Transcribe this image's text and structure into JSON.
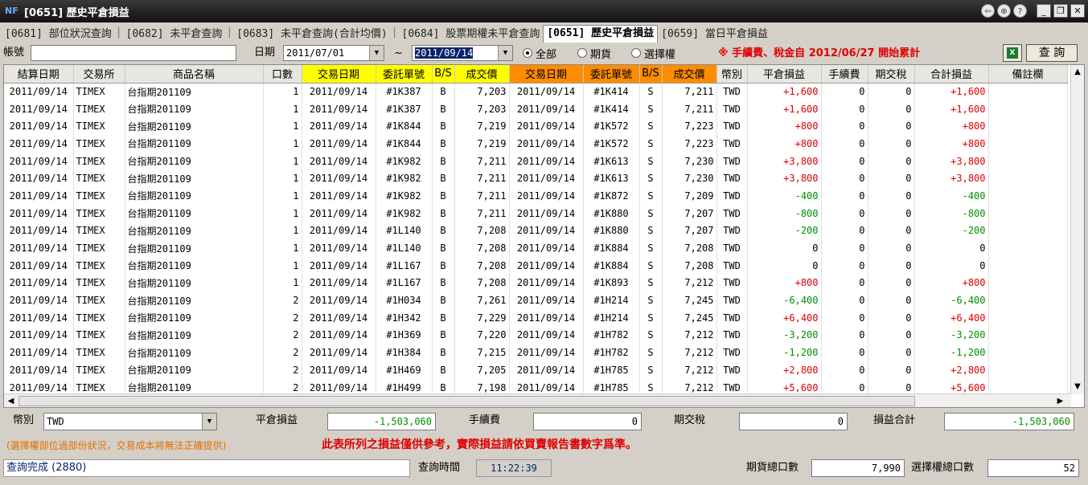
{
  "window": {
    "logo": "NF",
    "title": "[0651] 歷史平倉損益",
    "controls": [
      "⇦",
      "⊕",
      "?",
      "_",
      "❐",
      "✕"
    ]
  },
  "tabs": [
    {
      "label": "[0681] 部位狀況查詢",
      "active": false
    },
    {
      "label": "[0682] 未平倉查詢",
      "active": false
    },
    {
      "label": "[0683] 未平倉查詢(合計均價)",
      "active": false
    },
    {
      "label": "[0684] 股票期權未平倉查詢",
      "active": false
    },
    {
      "label": "[0651] 歷史平倉損益",
      "active": true
    },
    {
      "label": "[0659] 當日平倉損益",
      "active": false
    }
  ],
  "filter": {
    "account_label": "帳號",
    "account_value": "",
    "date_label": "日期",
    "date_from": "2011/07/01",
    "date_sep": "~",
    "date_to": "2011/09/14",
    "radio_all": "全部",
    "radio_futures": "期貨",
    "radio_options": "選擇權",
    "notice": "※ 手續費、稅金自 2012/06/27 開始累計",
    "query_button": "查 詢"
  },
  "table": {
    "headers": [
      "結算日期",
      "交易所",
      "商品名稱",
      "口數",
      "交易日期",
      "委託單號",
      "B/S",
      "成交價",
      "交易日期",
      "委託單號",
      "B/S",
      "成交價",
      "幣別",
      "平倉損益",
      "手續費",
      "期交稅",
      "合計損益",
      "備註欄"
    ],
    "rows": [
      [
        "2011/09/14",
        "TIMEX",
        "台指期201109",
        "1",
        "2011/09/14",
        "#1K387",
        "B",
        "7,203",
        "2011/09/14",
        "#1K414",
        "S",
        "7,211",
        "TWD",
        "+1,600",
        "0",
        "0",
        "+1,600",
        ""
      ],
      [
        "2011/09/14",
        "TIMEX",
        "台指期201109",
        "1",
        "2011/09/14",
        "#1K387",
        "B",
        "7,203",
        "2011/09/14",
        "#1K414",
        "S",
        "7,211",
        "TWD",
        "+1,600",
        "0",
        "0",
        "+1,600",
        ""
      ],
      [
        "2011/09/14",
        "TIMEX",
        "台指期201109",
        "1",
        "2011/09/14",
        "#1K844",
        "B",
        "7,219",
        "2011/09/14",
        "#1K572",
        "S",
        "7,223",
        "TWD",
        "+800",
        "0",
        "0",
        "+800",
        ""
      ],
      [
        "2011/09/14",
        "TIMEX",
        "台指期201109",
        "1",
        "2011/09/14",
        "#1K844",
        "B",
        "7,219",
        "2011/09/14",
        "#1K572",
        "S",
        "7,223",
        "TWD",
        "+800",
        "0",
        "0",
        "+800",
        ""
      ],
      [
        "2011/09/14",
        "TIMEX",
        "台指期201109",
        "1",
        "2011/09/14",
        "#1K982",
        "B",
        "7,211",
        "2011/09/14",
        "#1K613",
        "S",
        "7,230",
        "TWD",
        "+3,800",
        "0",
        "0",
        "+3,800",
        ""
      ],
      [
        "2011/09/14",
        "TIMEX",
        "台指期201109",
        "1",
        "2011/09/14",
        "#1K982",
        "B",
        "7,211",
        "2011/09/14",
        "#1K613",
        "S",
        "7,230",
        "TWD",
        "+3,800",
        "0",
        "0",
        "+3,800",
        ""
      ],
      [
        "2011/09/14",
        "TIMEX",
        "台指期201109",
        "1",
        "2011/09/14",
        "#1K982",
        "B",
        "7,211",
        "2011/09/14",
        "#1K872",
        "S",
        "7,209",
        "TWD",
        "-400",
        "0",
        "0",
        "-400",
        ""
      ],
      [
        "2011/09/14",
        "TIMEX",
        "台指期201109",
        "1",
        "2011/09/14",
        "#1K982",
        "B",
        "7,211",
        "2011/09/14",
        "#1K880",
        "S",
        "7,207",
        "TWD",
        "-800",
        "0",
        "0",
        "-800",
        ""
      ],
      [
        "2011/09/14",
        "TIMEX",
        "台指期201109",
        "1",
        "2011/09/14",
        "#1L140",
        "B",
        "7,208",
        "2011/09/14",
        "#1K880",
        "S",
        "7,207",
        "TWD",
        "-200",
        "0",
        "0",
        "-200",
        ""
      ],
      [
        "2011/09/14",
        "TIMEX",
        "台指期201109",
        "1",
        "2011/09/14",
        "#1L140",
        "B",
        "7,208",
        "2011/09/14",
        "#1K884",
        "S",
        "7,208",
        "TWD",
        "0",
        "0",
        "0",
        "0",
        ""
      ],
      [
        "2011/09/14",
        "TIMEX",
        "台指期201109",
        "1",
        "2011/09/14",
        "#1L167",
        "B",
        "7,208",
        "2011/09/14",
        "#1K884",
        "S",
        "7,208",
        "TWD",
        "0",
        "0",
        "0",
        "0",
        ""
      ],
      [
        "2011/09/14",
        "TIMEX",
        "台指期201109",
        "1",
        "2011/09/14",
        "#1L167",
        "B",
        "7,208",
        "2011/09/14",
        "#1K893",
        "S",
        "7,212",
        "TWD",
        "+800",
        "0",
        "0",
        "+800",
        ""
      ],
      [
        "2011/09/14",
        "TIMEX",
        "台指期201109",
        "2",
        "2011/09/14",
        "#1H034",
        "B",
        "7,261",
        "2011/09/14",
        "#1H214",
        "S",
        "7,245",
        "TWD",
        "-6,400",
        "0",
        "0",
        "-6,400",
        ""
      ],
      [
        "2011/09/14",
        "TIMEX",
        "台指期201109",
        "2",
        "2011/09/14",
        "#1H342",
        "B",
        "7,229",
        "2011/09/14",
        "#1H214",
        "S",
        "7,245",
        "TWD",
        "+6,400",
        "0",
        "0",
        "+6,400",
        ""
      ],
      [
        "2011/09/14",
        "TIMEX",
        "台指期201109",
        "2",
        "2011/09/14",
        "#1H369",
        "B",
        "7,220",
        "2011/09/14",
        "#1H782",
        "S",
        "7,212",
        "TWD",
        "-3,200",
        "0",
        "0",
        "-3,200",
        ""
      ],
      [
        "2011/09/14",
        "TIMEX",
        "台指期201109",
        "2",
        "2011/09/14",
        "#1H384",
        "B",
        "7,215",
        "2011/09/14",
        "#1H782",
        "S",
        "7,212",
        "TWD",
        "-1,200",
        "0",
        "0",
        "-1,200",
        ""
      ],
      [
        "2011/09/14",
        "TIMEX",
        "台指期201109",
        "2",
        "2011/09/14",
        "#1H469",
        "B",
        "7,205",
        "2011/09/14",
        "#1H785",
        "S",
        "7,212",
        "TWD",
        "+2,800",
        "0",
        "0",
        "+2,800",
        ""
      ],
      [
        "2011/09/14",
        "TIMEX",
        "台指期201109",
        "2",
        "2011/09/14",
        "#1H499",
        "B",
        "7,198",
        "2011/09/14",
        "#1H785",
        "S",
        "7,212",
        "TWD",
        "+5,600",
        "0",
        "0",
        "+5,600",
        ""
      ]
    ]
  },
  "scrollbar": {
    "up": "▲",
    "down": "▼",
    "left": "◀",
    "right": "▶"
  },
  "summary": {
    "currency_label": "幣別",
    "currency_value": "TWD",
    "pnl_label": "平倉損益",
    "pnl_value": "-1,503,060",
    "fee_label": "手續費",
    "fee_value": "0",
    "tax_label": "期交稅",
    "tax_value": "0",
    "total_label": "損益合計",
    "total_value": "-1,503,060"
  },
  "notes": {
    "orange": "(選擇權部位過部份狀況，交易成本將無法正確提供)",
    "red": "此表所列之損益僅供參考，實際損益請依買賣報告書數字爲準。"
  },
  "status": {
    "message": "查詢完成 (2880)",
    "time_label": "查詢時間",
    "time_value": "11:22:39",
    "futures_label": "期貨總口數",
    "futures_value": "7,990",
    "options_label": "選擇權總口數",
    "options_value": "52"
  },
  "colors": {
    "header_yellow": "#ffff00",
    "header_orange": "#ff8c00",
    "profit": "#e00000",
    "loss": "#009000"
  }
}
